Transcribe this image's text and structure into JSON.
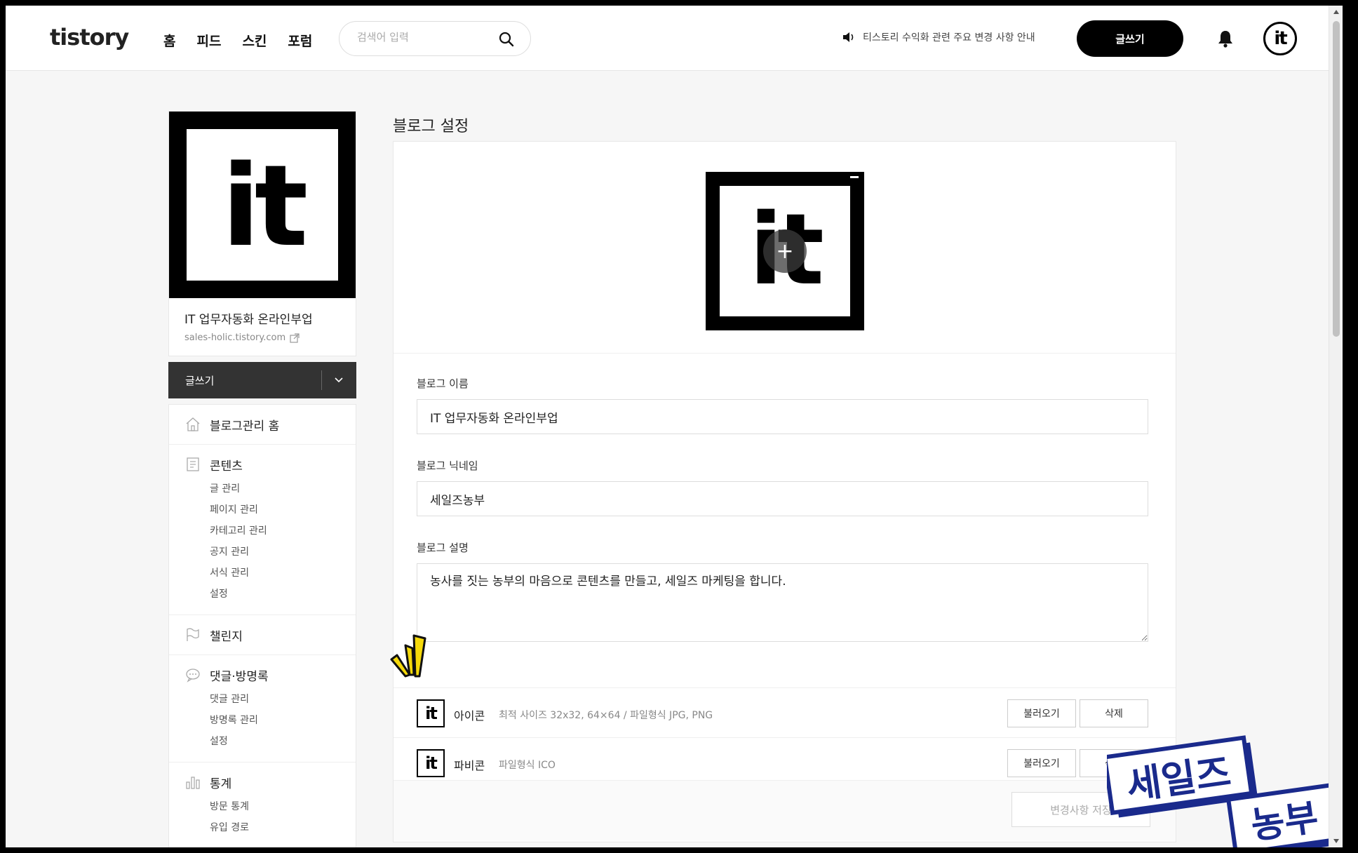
{
  "header": {
    "logo": "tistory",
    "nav": [
      "홈",
      "피드",
      "스킨",
      "포럼"
    ],
    "search_placeholder": "검색어 입력",
    "notice": "티스토리 수익화 관련 주요 변경 사항 안내",
    "write_label": "글쓰기",
    "avatar_text": "it"
  },
  "sidebar": {
    "logo_text": "it",
    "blog_title": "IT 업무자동화 온라인부업",
    "blog_url": "sales-holic.tistory.com",
    "write_label": "글쓰기",
    "menu": [
      {
        "id": "home",
        "label": "블로그관리 홈",
        "icon": "home-icon",
        "items": []
      },
      {
        "id": "contents",
        "label": "콘텐츠",
        "icon": "document-icon",
        "items": [
          "글 관리",
          "페이지 관리",
          "카테고리 관리",
          "공지 관리",
          "서식 관리",
          "설정"
        ]
      },
      {
        "id": "challenge",
        "label": "챌린지",
        "icon": "flag-icon",
        "items": []
      },
      {
        "id": "comments",
        "label": "댓글·방명록",
        "icon": "speech-bubble-icon",
        "items": [
          "댓글 관리",
          "방명록 관리",
          "설정"
        ]
      },
      {
        "id": "stats",
        "label": "통계",
        "icon": "bar-chart-icon",
        "items": [
          "방문 통계",
          "유입 경로"
        ]
      }
    ]
  },
  "main": {
    "title": "블로그 설정",
    "logo_text": "it",
    "name_label": "블로그 이름",
    "name_value": "IT 업무자동화 온라인부업",
    "nickname_label": "블로그 닉네임",
    "nickname_value": "세일즈농부",
    "desc_label": "블로그 설명",
    "desc_value": "농사를 짓는 농부의 마음으로 콘텐츠를 만들고, 세일즈 마케팅을 합니다.",
    "icon_row": {
      "thumb": "it",
      "name": "아이콘",
      "desc": "최적 사이즈 32x32, 64×64 / 파일형식 JPG, PNG",
      "load": "불러오기",
      "delete": "삭제"
    },
    "favicon_row": {
      "thumb": "it",
      "name": "파비콘",
      "desc": "파일형식 ICO",
      "load": "불러오기",
      "delete": "삭제"
    },
    "save_label": "변경사항 저장"
  },
  "overlay": {
    "stamp_line1": "세일즈",
    "stamp_line2": "농부",
    "stamp_color": "#1a2a8c",
    "spark_color": "#f5d90a"
  }
}
